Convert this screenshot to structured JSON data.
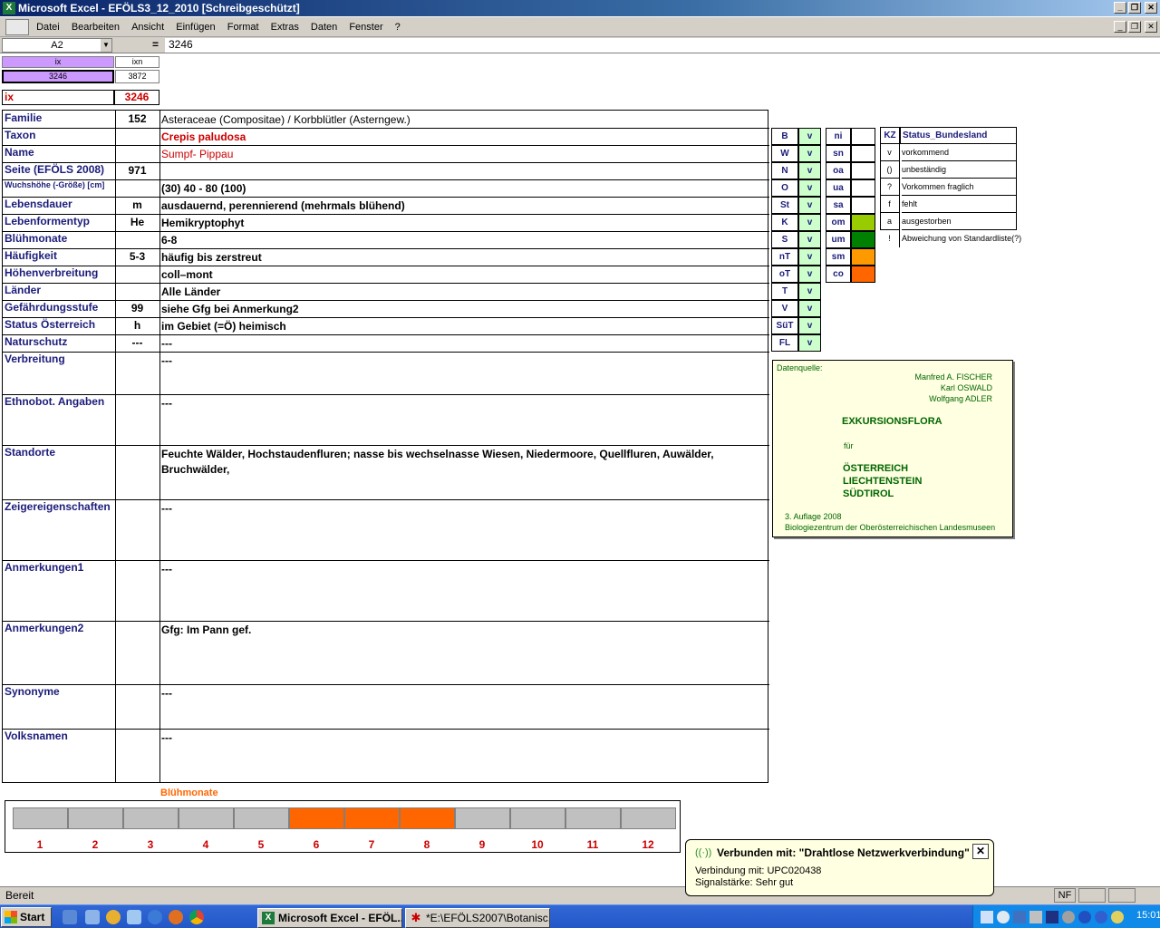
{
  "window": {
    "title": "Microsoft Excel - EFÖLS3_12_2010  [Schreibgeschützt]"
  },
  "menu": [
    "Datei",
    "Bearbeiten",
    "Ansicht",
    "Einfügen",
    "Format",
    "Extras",
    "Daten",
    "Fenster",
    "?"
  ],
  "formula": {
    "cell_ref": "A2",
    "eq": "=",
    "value": "3246"
  },
  "index": {
    "ix_header": "ix",
    "ixn_header": "ixn",
    "ix_value": "3246",
    "ixn_value": "3872",
    "ix_label": "ix",
    "ix_big": "3246"
  },
  "fields": [
    {
      "label": "Familie",
      "code": "152",
      "value": "Asteraceae (Compositae)  /  Korbblütler (Asterngew.)"
    },
    {
      "label": "Taxon",
      "code": "",
      "value": "Crepis paludosa"
    },
    {
      "label": "Name",
      "code": "",
      "value": "Sumpf- Pippau"
    },
    {
      "label": "Seite (EFÖLS 2008)",
      "code": "971",
      "value": ""
    },
    {
      "label": "Wuchshöhe (-Größe) [cm]",
      "code": "",
      "value": "(30) 40 - 80 (100)"
    },
    {
      "label": "Lebensdauer",
      "code": "m",
      "value": "ausdauernd, perennierend (mehrmals blühend)"
    },
    {
      "label": "Lebenformentyp",
      "code": "He",
      "value": "Hemikryptophyt"
    },
    {
      "label": "Blühmonate",
      "code": "",
      "value": "6-8"
    },
    {
      "label": "Häufigkeit",
      "code": "5-3",
      "value": "häufig bis zerstreut"
    },
    {
      "label": "Höhenverbreitung",
      "code": "",
      "value": "coll–mont"
    },
    {
      "label": "Länder",
      "code": "",
      "value": "Alle Länder"
    },
    {
      "label": "Gefährdungsstufe",
      "code": "99",
      "value": "siehe Gfg bei Anmerkung2"
    },
    {
      "label": "Status Österreich",
      "code": "h",
      "value": "im Gebiet (=Ö) heimisch"
    },
    {
      "label": "Naturschutz",
      "code": "---",
      "value": "---"
    },
    {
      "label": "Verbreitung",
      "code": "",
      "value": "---"
    },
    {
      "label": "Ethnobot. Angaben",
      "code": "",
      "value": "---"
    },
    {
      "label": "Standorte",
      "code": "",
      "value": "Feuchte Wälder, Hochstaudenfluren; nasse bis wechselnasse Wiesen, Niedermoore, Quellfluren, Auwälder, Bruchwälder,"
    },
    {
      "label": "Zeigereigenschaften",
      "code": "",
      "value": "---"
    },
    {
      "label": "Anmerkungen1",
      "code": "",
      "value": "---"
    },
    {
      "label": "Anmerkungen2",
      "code": "",
      "value": "Gfg:  Im Pann gef."
    },
    {
      "label": "Synonyme",
      "code": "",
      "value": "---"
    },
    {
      "label": "Volksnamen",
      "code": "",
      "value": "---"
    }
  ],
  "states": [
    {
      "code": "B",
      "v": "v"
    },
    {
      "code": "W",
      "v": "v"
    },
    {
      "code": "N",
      "v": "v"
    },
    {
      "code": "O",
      "v": "v"
    },
    {
      "code": "St",
      "v": "v"
    },
    {
      "code": "K",
      "v": "v"
    },
    {
      "code": "S",
      "v": "v"
    },
    {
      "code": "nT",
      "v": "v"
    },
    {
      "code": "oT",
      "v": "v"
    },
    {
      "code": "T",
      "v": "v"
    },
    {
      "code": "V",
      "v": "v"
    },
    {
      "code": "SüT",
      "v": "v"
    },
    {
      "code": "FL",
      "v": "v"
    }
  ],
  "zones": [
    {
      "code": "ni",
      "color": "#ffffff"
    },
    {
      "code": "sn",
      "color": "#ffffff"
    },
    {
      "code": "oa",
      "color": "#ffffff"
    },
    {
      "code": "ua",
      "color": "#ffffff"
    },
    {
      "code": "sa",
      "color": "#ffffff"
    },
    {
      "code": "om",
      "color": "#99cc00"
    },
    {
      "code": "um",
      "color": "#008000"
    },
    {
      "code": "sm",
      "color": "#ff9900"
    },
    {
      "code": "co",
      "color": "#ff6600"
    }
  ],
  "legend": {
    "header_kz": "KZ",
    "header_status": "Status_Bundesland",
    "rows": [
      {
        "kz": "v",
        "text": "vorkommend"
      },
      {
        "kz": "()",
        "text": "unbeständig"
      },
      {
        "kz": "?",
        "text": "Vorkommen fraglich"
      },
      {
        "kz": "f",
        "text": "fehlt"
      },
      {
        "kz": "a",
        "text": "ausgestorben"
      },
      {
        "kz": "!",
        "text": "Abweichung von Standardliste(?)"
      }
    ]
  },
  "source": {
    "heading": "Datenquelle:",
    "authors": [
      "Manfred A. FISCHER",
      "Karl OSWALD",
      "Wolfgang ADLER"
    ],
    "book": "EXKURSIONSFLORA",
    "fuer": "für",
    "countries": [
      "ÖSTERREICH",
      "LIECHTENSTEIN",
      "SÜDTIROL"
    ],
    "edition": "3. Auflage 2008",
    "publisher": "Biologiezentrum der Oberösterreichischen Landesmuseen"
  },
  "bloom": {
    "title": "Blühmonate",
    "months": [
      "1",
      "2",
      "3",
      "4",
      "5",
      "6",
      "7",
      "8",
      "9",
      "10",
      "11",
      "12"
    ],
    "active": [
      6,
      7,
      8
    ],
    "active_color": "#ff6600",
    "inactive_color": "#c0c0c0"
  },
  "status": {
    "text": "Bereit",
    "nf": "NF"
  },
  "balloon": {
    "title": "Verbunden mit: \"Drahtlose Netzwerkverbindung\"",
    "line1": "Verbindung mit: UPC020438",
    "line2": "Signalstärke: Sehr gut"
  },
  "taskbar": {
    "start": "Start",
    "tasks": [
      "Microsoft Excel - EFÖL...",
      "*E:\\EFÖLS2007\\Botanisc..."
    ],
    "clock": "15:01"
  }
}
